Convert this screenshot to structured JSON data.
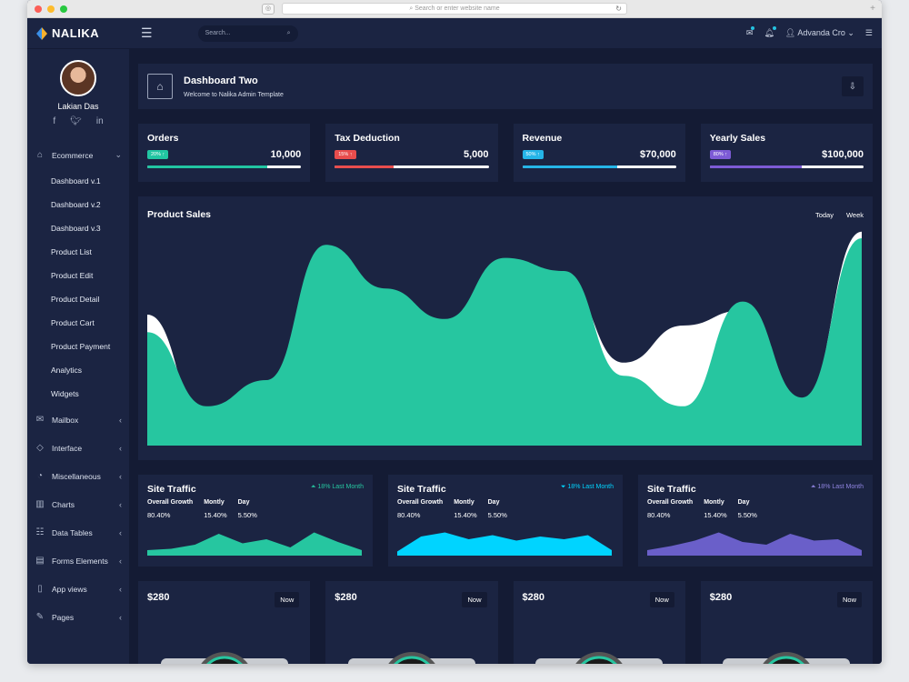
{
  "browser": {
    "url_placeholder": "Search or enter website name"
  },
  "topbar": {
    "brand": "NALIKA",
    "search_placeholder": "Search...",
    "user_name": "Advanda Cro"
  },
  "sidebar": {
    "profile_name": "Lakian Das",
    "items": [
      {
        "label": "Ecommerce",
        "icon": "home-icon",
        "expanded": true
      },
      {
        "label": "Mailbox",
        "icon": "mail-icon"
      },
      {
        "label": "Interface",
        "icon": "diamond-icon"
      },
      {
        "label": "Miscellaneous",
        "icon": "pie-icon"
      },
      {
        "label": "Charts",
        "icon": "chart-icon"
      },
      {
        "label": "Data Tables",
        "icon": "table-icon"
      },
      {
        "label": "Forms Elements",
        "icon": "form-icon"
      },
      {
        "label": "App views",
        "icon": "phone-icon"
      },
      {
        "label": "Pages",
        "icon": "edit-icon"
      }
    ],
    "sub_items": [
      "Dashboard v.1",
      "Dashboard v.2",
      "Dashboard v.3",
      "Product List",
      "Product Edit",
      "Product Detail",
      "Product Cart",
      "Product Payment",
      "Analytics",
      "Widgets"
    ]
  },
  "header": {
    "title": "Dashboard Two",
    "subtitle": "Welcome to Nalika Admin Template"
  },
  "stats": [
    {
      "label": "Orders",
      "pill": "20% ↑",
      "value": "10,000",
      "color": "#22c5a2",
      "progress": 0.78
    },
    {
      "label": "Tax Deduction",
      "pill": "15% ↑",
      "value": "5,000",
      "color": "#e84d4d",
      "progress": 0.38
    },
    {
      "label": "Revenue",
      "pill": "50% ↑",
      "value": "$70,000",
      "color": "#25b5e8",
      "progress": 0.62
    },
    {
      "label": "Yearly Sales",
      "pill": "80% ↑",
      "value": "$100,000",
      "color": "#7d5bd6",
      "progress": 0.6
    }
  ],
  "sales": {
    "title": "Product Sales",
    "tabs": [
      "Today",
      "Week"
    ]
  },
  "chart_data": {
    "type": "area",
    "series": [
      {
        "values": [
          52,
          18,
          30,
          92,
          72,
          58,
          86,
          80,
          32,
          18,
          66,
          22,
          95
        ],
        "color": "#26c6a0"
      },
      {
        "values": [
          60,
          10,
          25,
          88,
          70,
          55,
          82,
          75,
          38,
          55,
          62,
          20,
          98
        ],
        "color": "#ffffff"
      }
    ],
    "ylim": [
      0,
      100
    ]
  },
  "traffic": [
    {
      "title": "Site Traffic",
      "change": "18% Last Month",
      "change_icon": "arrow-up-icon",
      "color": "#26c6a0",
      "cols": [
        {
          "h": "Overall Growth",
          "v": "80.40%"
        },
        {
          "h": "Montly",
          "v": "15.40%"
        },
        {
          "h": "Day",
          "v": "5.50%"
        }
      ],
      "values": [
        20,
        25,
        40,
        80,
        45,
        60,
        30,
        85,
        50,
        20
      ]
    },
    {
      "title": "Site Traffic",
      "change": "18% Last Month",
      "change_icon": "arrow-down-icon",
      "color": "#00d4ff",
      "cols": [
        {
          "h": "Overall Growth",
          "v": "80.40%"
        },
        {
          "h": "Montly",
          "v": "15.40%"
        },
        {
          "h": "Day",
          "v": "5.50%"
        }
      ],
      "values": [
        15,
        70,
        85,
        60,
        75,
        55,
        70,
        60,
        75,
        20
      ]
    },
    {
      "title": "Site Traffic",
      "change": "18% Last Month",
      "change_icon": "arrow-up-icon",
      "color": "#6a5fc9",
      "cols": [
        {
          "h": "Overall Growth",
          "v": "80.40%"
        },
        {
          "h": "Montly",
          "v": "15.40%"
        },
        {
          "h": "Day",
          "v": "5.50%"
        }
      ],
      "values": [
        20,
        35,
        55,
        85,
        50,
        40,
        80,
        55,
        60,
        20
      ]
    }
  ],
  "products": [
    {
      "price": "$280",
      "button": "Now"
    },
    {
      "price": "$280",
      "button": "Now"
    },
    {
      "price": "$280",
      "button": "Now"
    },
    {
      "price": "$280",
      "button": "Now"
    }
  ]
}
